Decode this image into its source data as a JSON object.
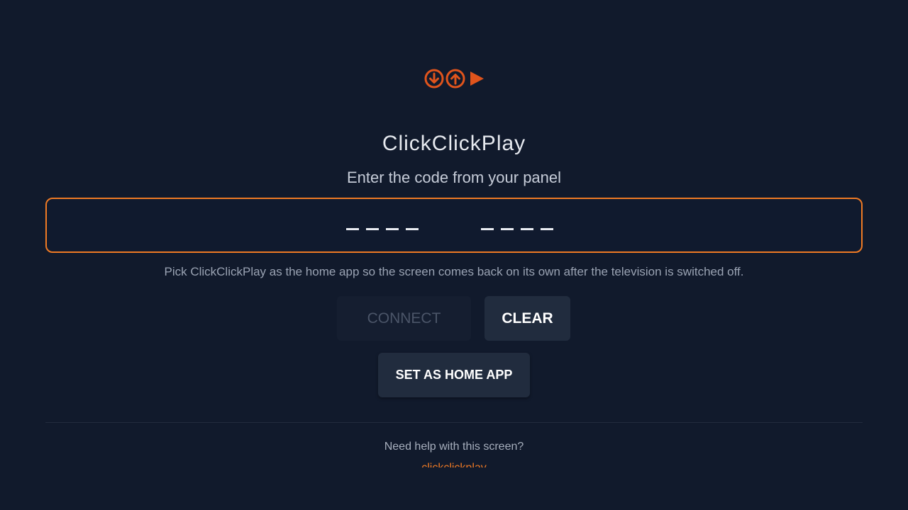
{
  "app": {
    "logo_icon": "download-upload-play-logo",
    "title": "ClickClickPlay",
    "subtitle": "Enter the code from your panel"
  },
  "code_entry": {
    "slots_first_group": 4,
    "slots_second_group": 4,
    "value": ""
  },
  "hint": "Pick ClickClickPlay as the home app so the screen comes back on its own after the television is switched off.",
  "buttons": {
    "connect": "CONNECT",
    "clear": "CLEAR",
    "set_home": "SET AS HOME APP"
  },
  "help": {
    "question": "Need help with this screen?",
    "link": "clickclickplay"
  },
  "colors": {
    "background": "#111a2c",
    "accent": "#ef7a24",
    "logo": "#e0541c"
  }
}
